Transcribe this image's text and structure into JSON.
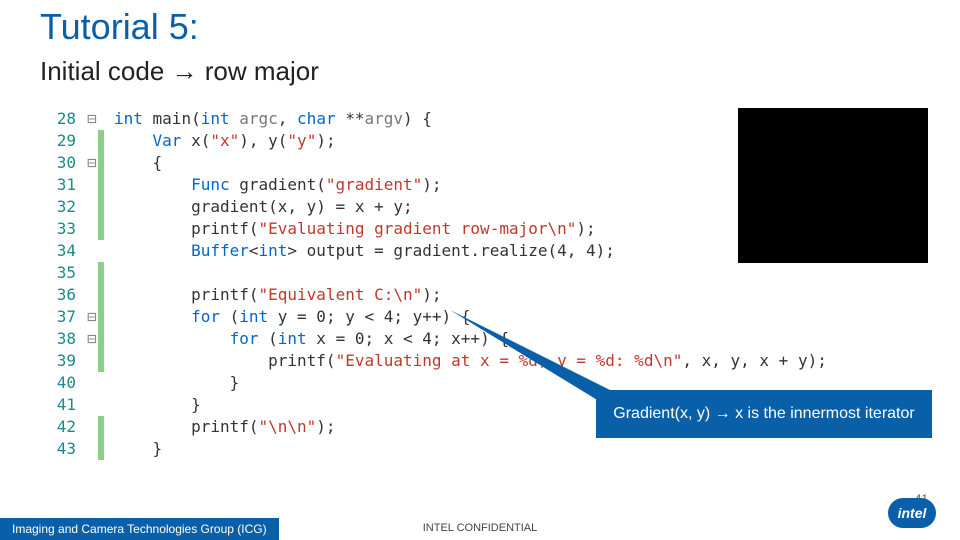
{
  "title": "Tutorial 5:",
  "subtitle": "Initial code → row major",
  "code": {
    "lines": [
      {
        "n": "28",
        "g": "⊟",
        "t": "int main(int argc, char **argv) {"
      },
      {
        "n": "29",
        "g": "",
        "t": "    Var x(\"x\"), y(\"y\");"
      },
      {
        "n": "30",
        "g": "⊟",
        "t": "    {"
      },
      {
        "n": "31",
        "g": "",
        "t": "        Func gradient(\"gradient\");"
      },
      {
        "n": "32",
        "g": "",
        "t": "        gradient(x, y) = x + y;"
      },
      {
        "n": "33",
        "g": "",
        "t": "        printf(\"Evaluating gradient row-major\\n\");"
      },
      {
        "n": "34",
        "g": "",
        "t": "        Buffer<int> output = gradient.realize(4, 4);"
      },
      {
        "n": "35",
        "g": "",
        "t": ""
      },
      {
        "n": "36",
        "g": "",
        "t": "        printf(\"Equivalent C:\\n\");"
      },
      {
        "n": "37",
        "g": "⊟",
        "t": "        for (int y = 0; y < 4; y++) {"
      },
      {
        "n": "38",
        "g": "⊟",
        "t": "            for (int x = 0; x < 4; x++) {"
      },
      {
        "n": "39",
        "g": "",
        "t": "                printf(\"Evaluating at x = %d, y = %d: %d\\n\", x, y, x + y);"
      },
      {
        "n": "40",
        "g": "",
        "t": "            }"
      },
      {
        "n": "41",
        "g": "",
        "t": "        }"
      },
      {
        "n": "42",
        "g": "",
        "t": "        printf(\"\\n\\n\");"
      },
      {
        "n": "43",
        "g": "",
        "t": "    }"
      }
    ]
  },
  "callout": "Gradient(x, y) → x is the innermost iterator",
  "footer": {
    "group": "Imaging and Camera Technologies Group (ICG)",
    "conf": "INTEL CONFIDENTIAL",
    "page": "41",
    "brand": "intel"
  }
}
